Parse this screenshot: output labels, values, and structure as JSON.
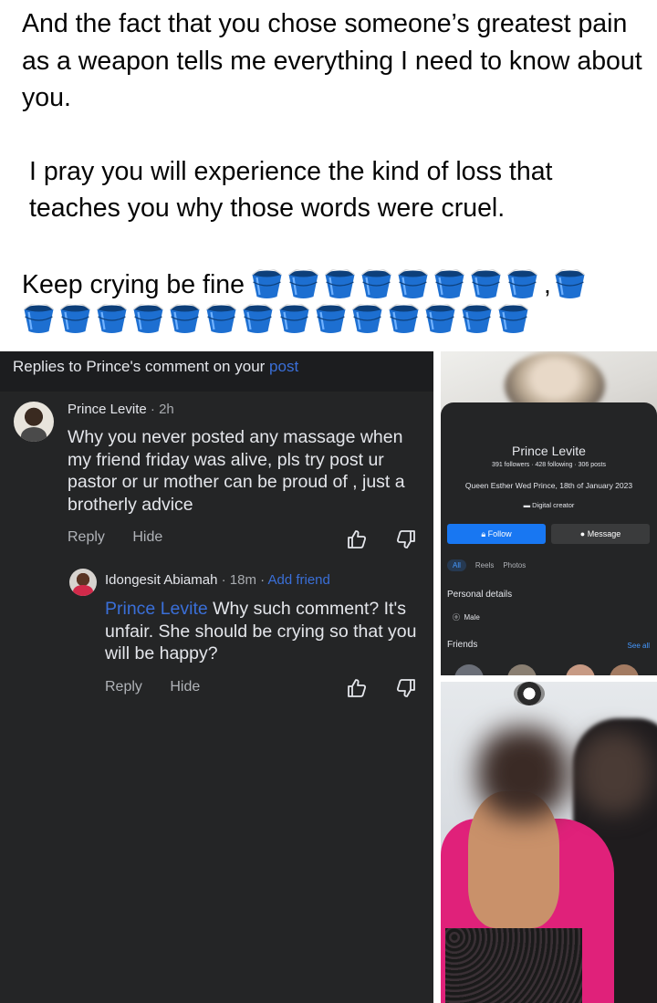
{
  "post": {
    "line1": "And the fact that you chose someone’s greatest pain as a weapon tells me everything I need to know about you.",
    "line2": "I pray you will experience the kind of loss that teaches you why those words were cruel.",
    "line3_text": "Keep crying be fine",
    "line3_comma": ",",
    "bucket_emoji": "🪣",
    "buckets_row1_before_comma": 8,
    "buckets_row1_after_comma": 1,
    "buckets_row2": 14
  },
  "replies_screen": {
    "header_prefix": "Replies to Prince's comment on your",
    "header_link": "post",
    "comment1": {
      "author": "Prince Levite",
      "time": "2h",
      "text": "Why you never posted any massage when my friend friday was alive, pls  try post ur pastor or ur mother can be proud of , just a brotherly advice",
      "reply": "Reply",
      "hide": "Hide"
    },
    "comment2": {
      "author": "Idongesit Abiamah",
      "time": "18m",
      "add_friend": "Add friend",
      "mention": "Prince Levite",
      "text": " Why such comment? It's unfair. She should be crying  so that you will be happy?",
      "reply": "Reply",
      "hide": "Hide"
    }
  },
  "profile_screen": {
    "name": "Prince Levite",
    "stats": "391 followers · 428 following · 306 posts",
    "bio": "Queen Esther Wed Prince, 18th  of January 2023",
    "category": "Digital creator",
    "follow": "Follow",
    "message": "Message",
    "tabs": [
      "All",
      "Reels",
      "Photos"
    ],
    "personal_details": "Personal details",
    "gender": "Male",
    "friends": "Friends",
    "see_all": "See all"
  },
  "colors": {
    "dark_bg": "#242526",
    "link_blue": "#3a6fd8",
    "bucket_blue": "#1d6fd1",
    "follow_blue": "#1877f2"
  }
}
